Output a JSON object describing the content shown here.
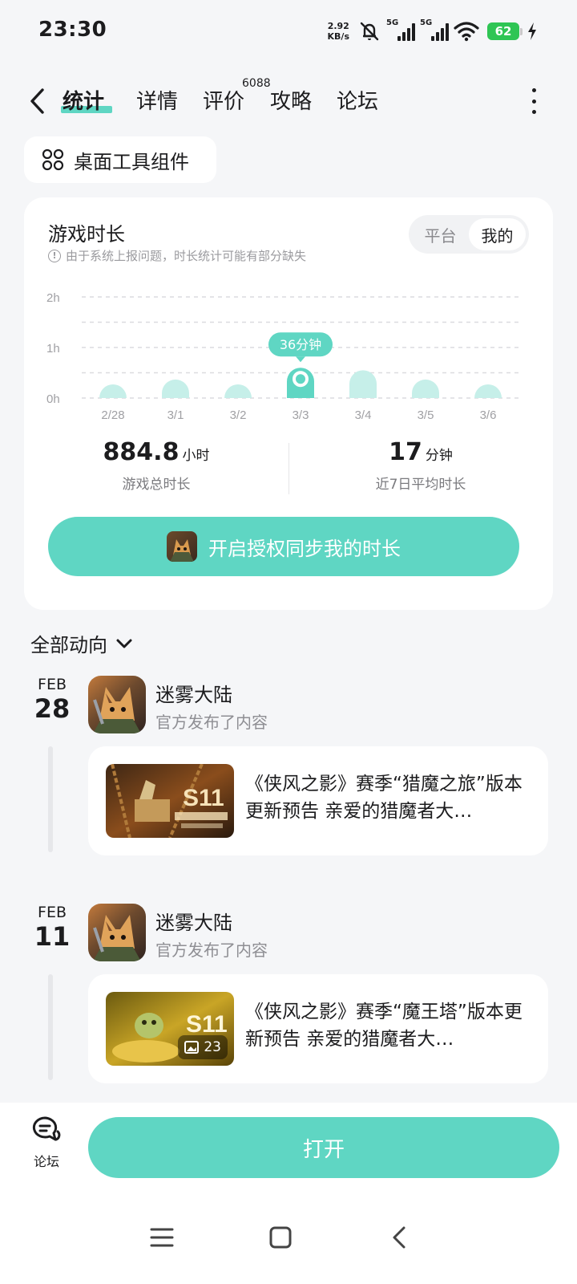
{
  "status_bar": {
    "time": "23:30",
    "net_speed_value": "2.92",
    "net_speed_unit": "KB/s",
    "sim1": "5G",
    "sim2": "5G",
    "battery": "62"
  },
  "nav": {
    "tabs": [
      {
        "label": "统计",
        "active": true
      },
      {
        "label": "详情"
      },
      {
        "label": "评价",
        "badge": "6088"
      },
      {
        "label": "攻略"
      },
      {
        "label": "论坛"
      }
    ]
  },
  "widget_button": {
    "label": "桌面工具组件",
    "icon": "widget-grid-icon"
  },
  "playtime": {
    "title": "游戏时长",
    "note": "由于系统上报问题，时长统计可能有部分缺失",
    "toggle": [
      "平台",
      "我的"
    ],
    "toggle_selected": "我的",
    "total_value": "884.8",
    "total_unit": "小时",
    "total_label": "游戏总时长",
    "avg_value": "17",
    "avg_unit": "分钟",
    "avg_label": "近7日平均时长",
    "sync_button": "开启授权同步我的时长"
  },
  "chart_data": {
    "type": "bar",
    "categories": [
      "2/28",
      "3/1",
      "3/2",
      "3/3",
      "3/4",
      "3/5",
      "3/6"
    ],
    "values": [
      8,
      22,
      8,
      36,
      33,
      22,
      15
    ],
    "unit": "minutes",
    "y_ticks": [
      "0h",
      "1h",
      "2h"
    ],
    "ylim": [
      0,
      120
    ],
    "highlight_index": 3,
    "highlight_label": "36分钟",
    "grid": true,
    "colors": {
      "bar": "#c6efe9",
      "highlight": "#5fd6c3"
    }
  },
  "feed": {
    "filter_label": "全部动向",
    "items": [
      {
        "month": "FEB",
        "day": "28",
        "app_name": "迷雾大陆",
        "subtitle": "官方发布了内容",
        "post_text": "《侠风之影》赛季“猎魔之旅”版本更新预告 亲爱的猎魔者大…",
        "thumb_text": "S11"
      },
      {
        "month": "FEB",
        "day": "11",
        "app_name": "迷雾大陆",
        "subtitle": "官方发布了内容",
        "post_text": "《侠风之影》赛季“魔王塔”版本更新预告 亲爱的猎魔者大…",
        "thumb_text": "S11",
        "image_count": "23"
      }
    ]
  },
  "bottom_bar": {
    "forum_label": "论坛",
    "open_button": "打开"
  },
  "colors": {
    "accent": "#5fd6c3",
    "bar_light": "#c6efe9",
    "background": "#f5f6f8"
  }
}
